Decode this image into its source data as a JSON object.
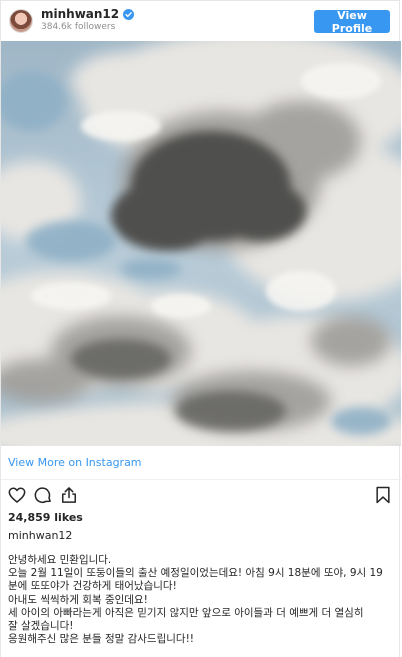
{
  "header": {
    "username": "minhwan12",
    "followers": "384.6k followers",
    "view_profile_label": "View Profile"
  },
  "links": {
    "view_more": "View More on Instagram"
  },
  "post": {
    "likes": "24,859 likes",
    "caption_username": "minhwan12",
    "caption_lines": [
      "안녕하세요 민환입니다.",
      "오늘 2월 11일이 또둥이들의 출산 예정일이었는데요! 아침 9시 18분에 또야, 9시 19",
      "분에 또또야가 건강하게 태어났습니다!",
      "아내도 씩씩하게 회복 중인데요!",
      "세 아이의 아빠라는게 아직은 믿기지 않지만 앞으로 아이들과 더 예쁘게 더 열심히",
      "잘 살겠습니다!",
      "응원해주신 많은 분들 정말 감사드립니다!!"
    ]
  },
  "icons": {
    "verified": "verified-badge-icon",
    "like": "heart-icon",
    "comment": "comment-icon",
    "share": "share-icon",
    "save": "bookmark-icon"
  },
  "colors": {
    "accent": "#3897f0",
    "text": "#262626",
    "muted": "#8e8e8e"
  }
}
